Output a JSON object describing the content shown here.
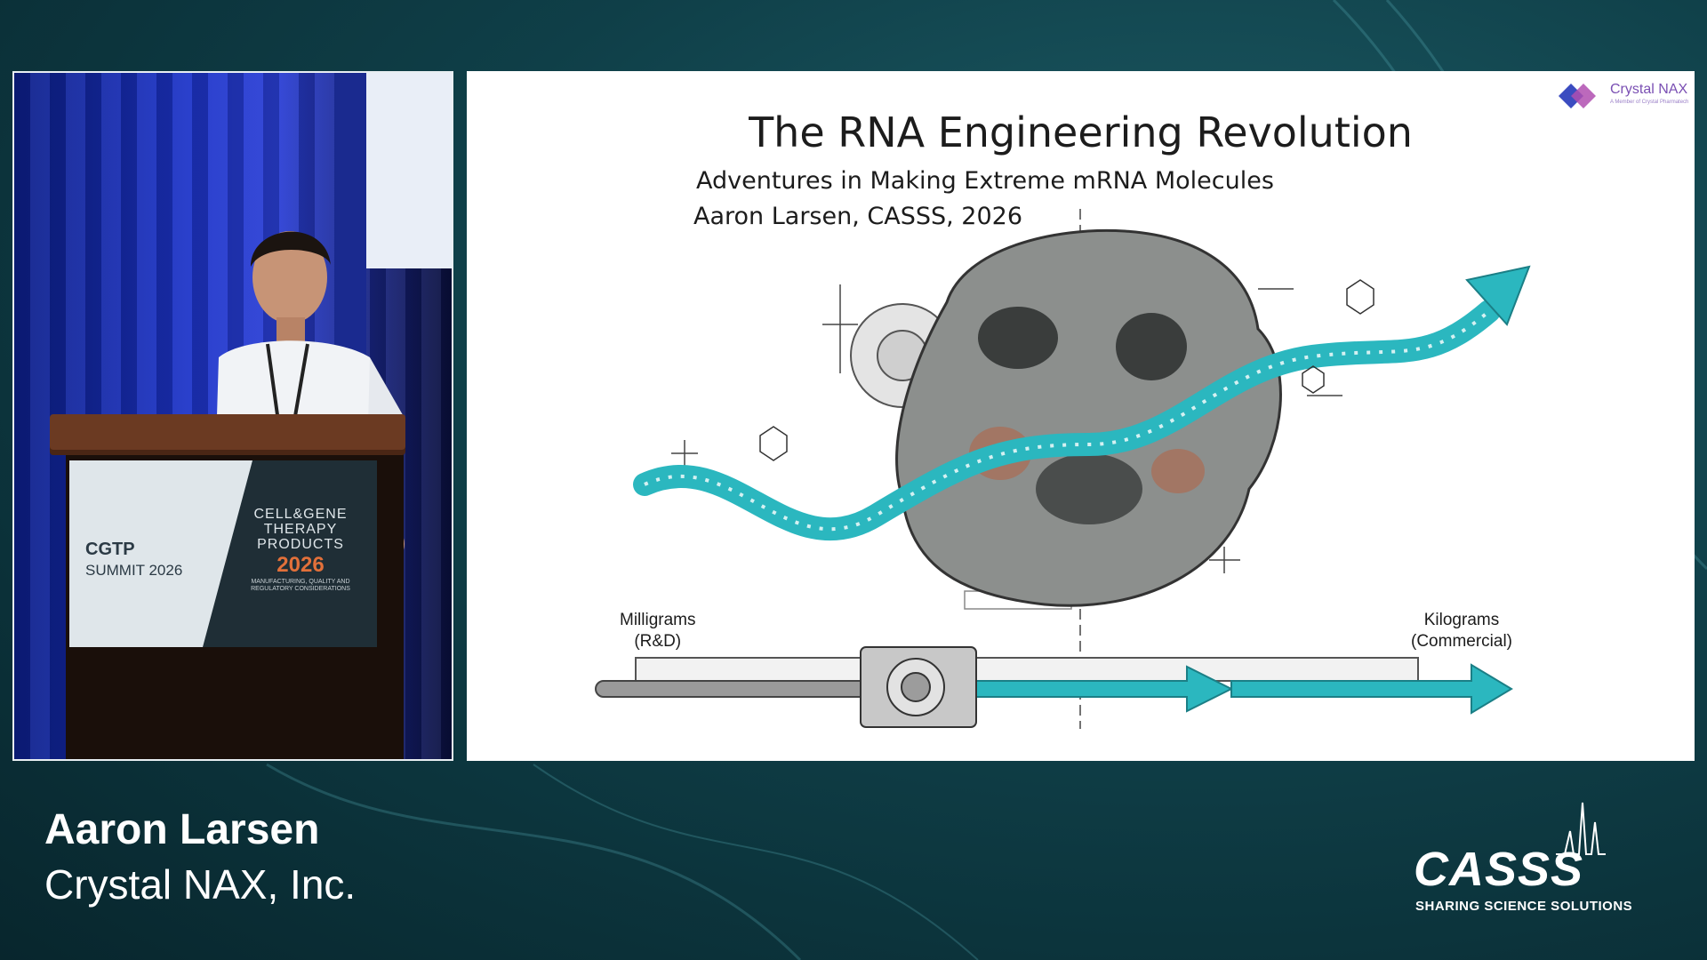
{
  "slide": {
    "title": "The RNA Engineering Revolution",
    "subtitle": "Adventures in Making Extreme mRNA Molecules",
    "byline": "Aaron Larsen, CASSS, 2026",
    "brand_name": "Crystal NAX",
    "brand_tagline": "A Member of Crystal Pharmatech",
    "label_left_line1": "Milligrams",
    "label_left_line2": "(R&D)",
    "label_right_line1": "Kilograms",
    "label_right_line2": "(Commercial)"
  },
  "podium_sign": {
    "left_title": "CGTP",
    "left_year": "SUMMIT 2026",
    "right_line1": "CELL&GENE",
    "right_line2": "THERAPY",
    "right_line3": "PRODUCTS",
    "right_year": "2026",
    "right_small1": "MANUFACTURING, QUALITY AND",
    "right_small2": "REGULATORY CONSIDERATIONS"
  },
  "lower_third": {
    "speaker_name": "Aaron Larsen",
    "speaker_org": "Crystal NAX, Inc."
  },
  "logo": {
    "wordmark": "CASSS",
    "tagline": "SHARING SCIENCE SOLUTIONS"
  },
  "colors": {
    "background": "#0f3f48",
    "teal_accent": "#2bb7bf",
    "curtain_blue": "#1d34c9",
    "brand_purple": "#7a4fb3"
  }
}
